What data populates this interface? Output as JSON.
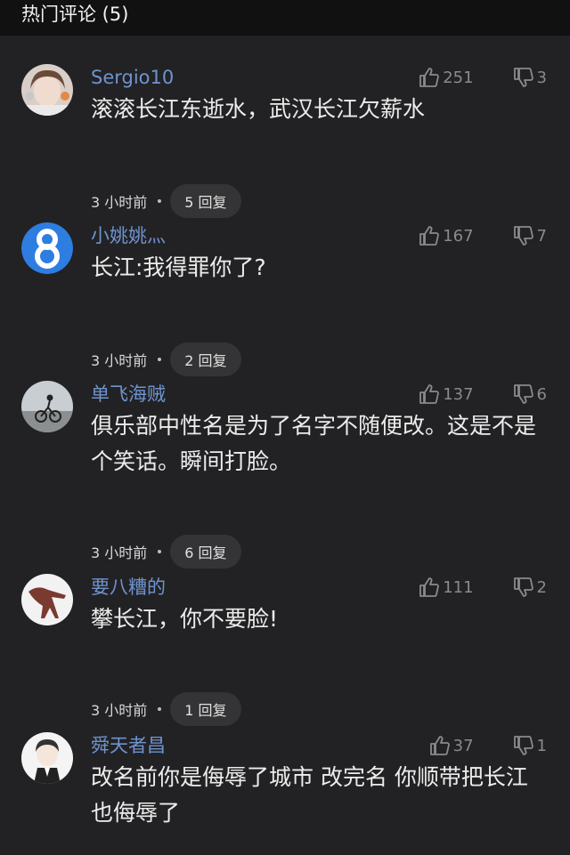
{
  "header": {
    "title": "热门评论 (5)"
  },
  "comments": [
    {
      "username": "Sergio10",
      "likes": "251",
      "dislikes": "3",
      "text": "滚滚长江东逝水，武汉长江欠薪水",
      "time": "3 小时前",
      "reply": "5 回复",
      "avatar": "girl-photo-avatar"
    },
    {
      "username": "小姚姚灬",
      "likes": "167",
      "dislikes": "7",
      "text": "长江:我得罪你了?",
      "time": "3 小时前",
      "reply": "2 回复",
      "avatar": "number-8-avatar"
    },
    {
      "username": "单飞海贼",
      "likes": "137",
      "dislikes": "6",
      "text": "俱乐部中性名是为了名字不随便改。这是不是个笑话。瞬间打脸。",
      "time": "3 小时前",
      "reply": "6 回复",
      "avatar": "cyclist-photo-avatar"
    },
    {
      "username": "要八糟的",
      "likes": "111",
      "dislikes": "2",
      "text": "攀长江，你不要脸!",
      "time": "3 小时前",
      "reply": "1 回复",
      "avatar": "dinosaur-avatar"
    },
    {
      "username": "舜天者昌",
      "likes": "37",
      "dislikes": "1",
      "text": "改名前你是侮辱了城市 改完名 你顺带把长江也侮辱了",
      "time": "",
      "reply": "",
      "avatar": "cartoon-boy-avatar"
    }
  ],
  "colors": {
    "background": "#222224",
    "header": "#111112",
    "username": "#6f93cf",
    "muted": "#8a8a8a"
  }
}
